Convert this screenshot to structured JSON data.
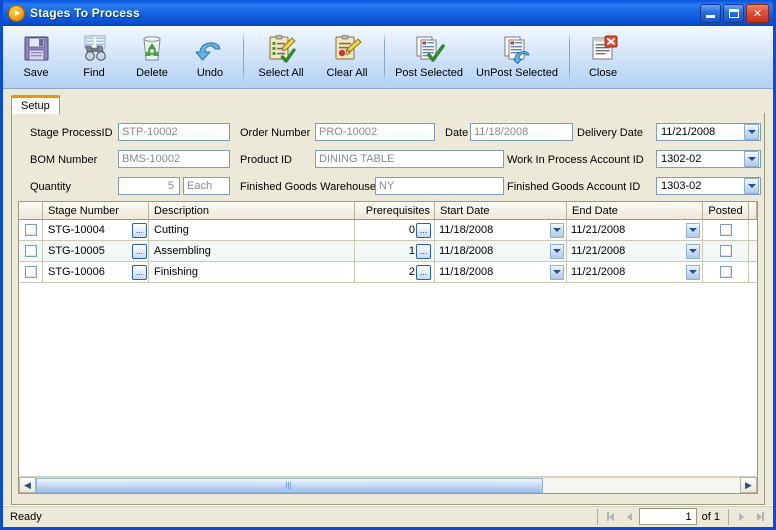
{
  "window": {
    "title": "Stages To Process",
    "icon": "play-circle-icon",
    "controls": {
      "minimize": "Minimize",
      "maximize": "Maximize",
      "close": "Close"
    }
  },
  "toolbar": {
    "buttons": [
      {
        "label": "Save",
        "icon": "floppy-disk-icon"
      },
      {
        "label": "Find",
        "icon": "binoculars-icon"
      },
      {
        "label": "Delete",
        "icon": "recycle-bin-icon"
      },
      {
        "label": "Undo",
        "icon": "undo-arrow-icon"
      },
      {
        "label": "Select All",
        "icon": "clipboard-pencil-check-icon"
      },
      {
        "label": "Clear All",
        "icon": "clipboard-eraser-icon"
      },
      {
        "label": "Post Selected",
        "icon": "documents-check-icon"
      },
      {
        "label": "UnPost Selected",
        "icon": "documents-undo-icon"
      },
      {
        "label": "Close",
        "icon": "document-close-icon"
      }
    ]
  },
  "tabs": [
    {
      "label": "Setup",
      "active": true
    }
  ],
  "form": {
    "stage_process_id": {
      "label": "Stage ProcessID",
      "value": "STP-10002"
    },
    "bom_number": {
      "label": "BOM Number",
      "value": "BMS-10002"
    },
    "quantity": {
      "label": "Quantity",
      "value": "5"
    },
    "uom": {
      "value": "Each"
    },
    "order_number": {
      "label": "Order Number",
      "value": "PRO-10002"
    },
    "product_id": {
      "label": "Product ID",
      "value": "DINING TABLE"
    },
    "fg_warehouse": {
      "label": "Finished Goods Warehouse",
      "value": "NY"
    },
    "date": {
      "label": "Date",
      "value": "11/18/2008"
    },
    "delivery_date": {
      "label": "Delivery Date",
      "value": "11/21/2008"
    },
    "wip_account_id": {
      "label": "Work In Process Account ID",
      "value": "1302-02"
    },
    "fg_account_id": {
      "label": "Finished Goods Account ID",
      "value": "1303-02"
    }
  },
  "grid": {
    "columns": [
      {
        "key": "select",
        "label": ""
      },
      {
        "key": "stage_number",
        "label": "Stage Number"
      },
      {
        "key": "description",
        "label": "Description"
      },
      {
        "key": "prerequisites",
        "label": "Prerequisites"
      },
      {
        "key": "start_date",
        "label": "Start Date"
      },
      {
        "key": "end_date",
        "label": "End Date"
      },
      {
        "key": "posted",
        "label": "Posted"
      }
    ],
    "rows": [
      {
        "selected": false,
        "stage_number": "STG-10004",
        "description": "Cutting",
        "prerequisites": "0",
        "start_date": "11/18/2008",
        "end_date": "11/21/2008",
        "posted": false
      },
      {
        "selected": false,
        "stage_number": "STG-10005",
        "description": "Assembling",
        "prerequisites": "1",
        "start_date": "11/18/2008",
        "end_date": "11/21/2008",
        "posted": false
      },
      {
        "selected": false,
        "stage_number": "STG-10006",
        "description": "Finishing",
        "prerequisites": "2",
        "start_date": "11/18/2008",
        "end_date": "11/21/2008",
        "posted": false
      }
    ],
    "ellipsis_label": "..."
  },
  "statusbar": {
    "message": "Ready",
    "page_value": "1",
    "of_label": "of  1",
    "nav": {
      "first": "First",
      "previous": "Previous",
      "next": "Next",
      "last": "Last"
    }
  },
  "colors": {
    "title_blue": "#1263E8",
    "frame_blue": "#0C4BD4",
    "client_tan": "#ECE9D8",
    "tab_accent": "#E8980C",
    "field_border": "#7D9DB8",
    "readonly_text": "#8A8A8A",
    "alt_row": "#F2F8F7"
  }
}
